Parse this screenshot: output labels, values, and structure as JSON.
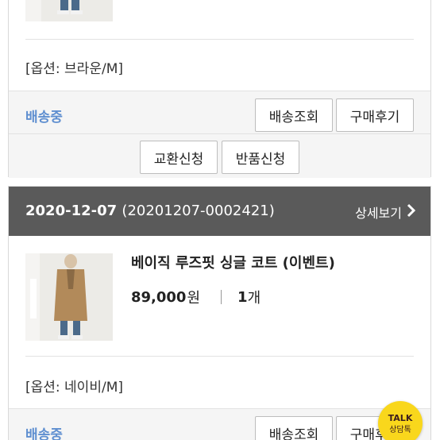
{
  "order1": {
    "option": "[옵션: 브라운/M]",
    "status": "배송중",
    "buttons": {
      "tracking": "배송조회",
      "review": "구매후기",
      "exchange": "교환신청",
      "return": "반품신청"
    }
  },
  "order2": {
    "date": "2020-12-07",
    "order_number": "(20201207-0002421)",
    "detail_link": "상세보기",
    "product_name": "베이직 루즈핏 싱글 코트 (이벤트)",
    "price": "89,000",
    "price_unit": "원",
    "quantity": "1",
    "quantity_unit": "개",
    "option": "[옵션: 네이비/M]",
    "status": "배송중",
    "buttons": {
      "tracking": "배송조회",
      "review": "구매후기"
    }
  },
  "kakao": {
    "icon_text": "TALK",
    "label": "상담톡"
  },
  "colors": {
    "status_blue": "#5f8fd0",
    "header_gray": "#5a5a5a",
    "kakao_yellow": "#f9d71c"
  }
}
